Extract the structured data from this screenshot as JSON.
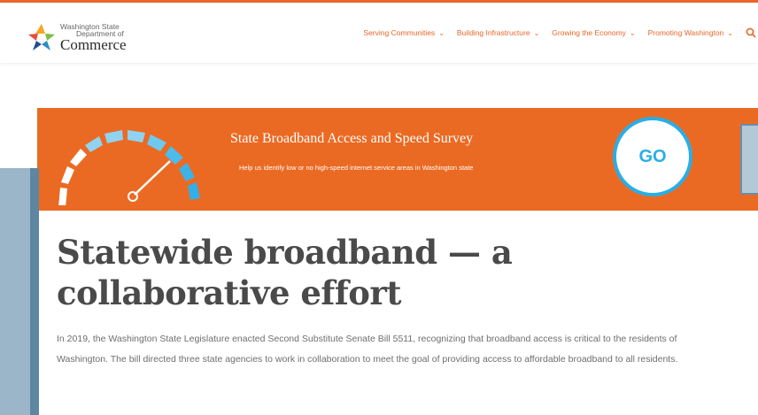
{
  "header": {
    "logo": {
      "line1": "Washington State",
      "line2": "Department of",
      "line3": "Commerce"
    },
    "nav": [
      {
        "label": "Serving Communities"
      },
      {
        "label": "Building Infrastructure"
      },
      {
        "label": "Growing the Economy"
      },
      {
        "label": "Promoting Washington"
      }
    ],
    "search_icon": "search-icon"
  },
  "banner": {
    "title": "State Broadband Access and Speed Survey",
    "subtitle": "Help us identify low or no high-speed internet service areas in Washington state",
    "go_label": "GO",
    "icon": "speedometer-icon",
    "colors": {
      "background": "#eb6a23",
      "accent": "#29aee6"
    }
  },
  "main": {
    "title": "Statewide broadband — a collaborative effort",
    "intro": "In 2019, the Washington State Legislature enacted Second Substitute Senate Bill 5511, recognizing that broadband access is critical to the residents of Washington. The bill directed three state agencies to work in collaboration to meet the goal of providing access to affordable broadband to all residents."
  }
}
